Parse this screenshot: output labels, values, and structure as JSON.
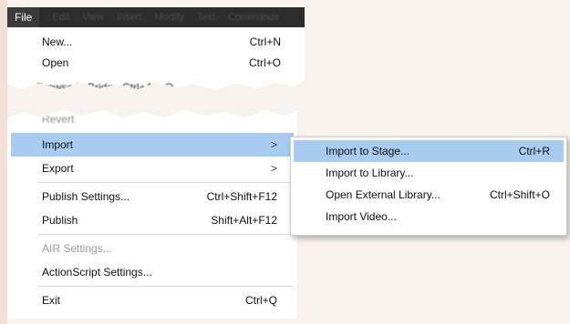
{
  "menubar": {
    "file_label": "File",
    "blurred_items": [
      "Edit",
      "View",
      "Insert",
      "Modify",
      "Text",
      "Commands"
    ]
  },
  "file_menu_top": [
    {
      "label": "New...",
      "shortcut": "Ctrl+N"
    },
    {
      "label": "Open",
      "shortcut": "Ctrl+O"
    }
  ],
  "blurred_row_text": "Browse in Bridge                Ctrl+Alt+O",
  "revert_text": "Revert",
  "file_menu_main": {
    "import": {
      "label": "Import",
      "arrow": ">"
    },
    "export": {
      "label": "Export",
      "arrow": ">"
    },
    "publish_settings": {
      "label": "Publish Settings...",
      "shortcut": "Ctrl+Shift+F12"
    },
    "publish": {
      "label": "Publish",
      "shortcut": "Shift+Alt+F12"
    },
    "air_settings": {
      "label": "AIR Settings..."
    },
    "actionscript_settings": {
      "label": "ActionScript Settings..."
    },
    "exit": {
      "label": "Exit",
      "shortcut": "Ctrl+Q"
    }
  },
  "import_submenu": {
    "import_to_stage": {
      "label": "Import to Stage...",
      "shortcut": "Ctrl+R"
    },
    "import_to_library": {
      "label": "Import to Library..."
    },
    "open_external_library": {
      "label": "Open External Library...",
      "shortcut": "Ctrl+Shift+O"
    },
    "import_video": {
      "label": "Import Video..."
    }
  },
  "colors": {
    "highlight": "#a8cbf0",
    "menubar_bg": "#2d2d2d",
    "disabled_text": "#9a9a9a"
  }
}
